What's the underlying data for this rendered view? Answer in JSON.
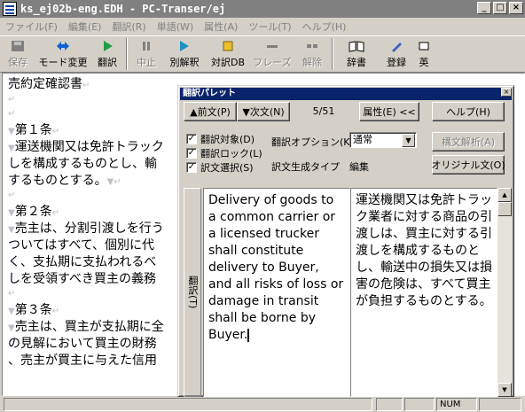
{
  "window": {
    "title": "ks_ej02b-eng.EDH - PC-Transer/ej",
    "min_label": "_",
    "max_label": "□",
    "close_label": "×"
  },
  "menu": [
    "ファイル(F)",
    "編集(E)",
    "翻訳(R)",
    "単語(W)",
    "属性(A)",
    "ツール(T)",
    "ヘルプ(H)"
  ],
  "toolbar": [
    {
      "label": "保存",
      "icon": "save-icon",
      "enabled": false
    },
    {
      "label": "モード変更",
      "icon": "mode-change-icon",
      "enabled": true
    },
    {
      "label": "翻訳",
      "icon": "play-icon",
      "enabled": true
    },
    {
      "label": "中止",
      "icon": "pause-icon",
      "enabled": false
    },
    {
      "label": "別解釈",
      "icon": "alternate-icon",
      "enabled": true
    },
    {
      "label": "対訳DB",
      "icon": "database-icon",
      "enabled": true
    },
    {
      "label": "フレーズ",
      "icon": "phrase-icon",
      "enabled": false
    },
    {
      "label": "解除",
      "icon": "release-icon",
      "enabled": false
    },
    {
      "label": "辞書",
      "icon": "dictionary-icon",
      "enabled": true
    },
    {
      "label": "登録",
      "icon": "register-icon",
      "enabled": true
    },
    {
      "label": "英",
      "icon": "english-icon",
      "enabled": true
    }
  ],
  "document": {
    "lines": [
      {
        "text": "売約定確認書",
        "mark": "↵"
      },
      {
        "text": "",
        "mark": "↵"
      },
      {
        "text": "",
        "mark": "↵"
      },
      {
        "text": "第１条",
        "mark": "↵",
        "lead": "▼"
      },
      {
        "text": "運送機関又は免許トラック",
        "mark": "",
        "lead": "▼"
      },
      {
        "text": "しを構成するものとし、輸",
        "mark": ""
      },
      {
        "text": "するものとする。",
        "mark": "↵",
        "trail": "▼"
      },
      {
        "text": "",
        "mark": "↵"
      },
      {
        "text": "第２条",
        "mark": "↵",
        "lead": "▼"
      },
      {
        "text": "売主は、分割引渡しを行う",
        "mark": "",
        "lead": "▼"
      },
      {
        "text": "ついてはすべて、個別に代",
        "mark": ""
      },
      {
        "text": "く、支払期に支払われるべ",
        "mark": ""
      },
      {
        "text": "しを受領すべき買主の義務",
        "mark": ""
      },
      {
        "text": "",
        "mark": "↵"
      },
      {
        "text": "第３条",
        "mark": "↵",
        "lead": "▼"
      },
      {
        "text": "売主は、買主が支払期に全",
        "mark": "",
        "lead": "▼"
      },
      {
        "text": "の見解において買主の財務",
        "mark": ""
      },
      {
        "text": "、売主が買主に与えた信用",
        "mark": ""
      }
    ]
  },
  "status": {
    "num": "NUM"
  },
  "palette": {
    "title": "翻訳パレット",
    "close": "×",
    "prev_label": "▲前文(P)",
    "next_label": "▼次文(N)",
    "counter": "5/51",
    "attr_label": "属性(E) <<",
    "help_label": "ヘルプ(H)",
    "checks": [
      {
        "label": "翻訳対象(D)",
        "checked": true
      },
      {
        "label": "翻訳ロック(L)",
        "checked": true
      },
      {
        "label": "訳文選択(S)",
        "checked": true
      }
    ],
    "option_label": "翻訳オプション(K)",
    "option_value": "通常",
    "gen_type_label": "訳文生成タイプ",
    "gen_type_value": "編集",
    "parse_label": "構文解析(A)",
    "original_label": "オリジナル文(O)",
    "translate_tab": "翻訳(T)",
    "english_text": "Delivery of goods to a common carrier or a licensed trucker shall constitute delivery to Buyer, and all risks of loss or damage in transit shall be borne by Buyer.",
    "japanese_text": "運送機関又は免許トラック業者に対する商品の引渡しは、買主に対する引渡しを構成するものとし、輸送中の損失又は損害の危険は、すべて買主が負担するものとする。"
  }
}
